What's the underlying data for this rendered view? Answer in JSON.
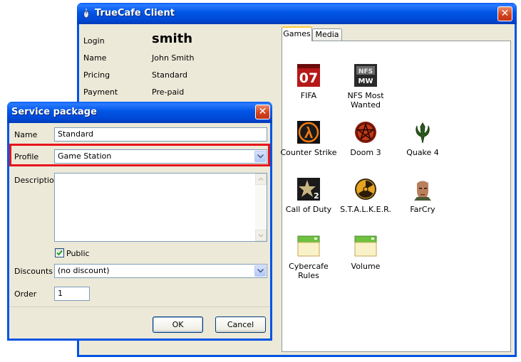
{
  "main_window": {
    "title": "TrueCafe Client",
    "info": [
      {
        "label": "Login",
        "value": "smith"
      },
      {
        "label": "Name",
        "value": "John Smith"
      },
      {
        "label": "Pricing",
        "value": "Standard"
      },
      {
        "label": "Payment",
        "value": "Pre-paid"
      }
    ],
    "tabs": [
      {
        "label": "Games",
        "selected": true
      },
      {
        "label": "Media",
        "selected": false
      }
    ],
    "games": [
      {
        "label": "FIFA",
        "icon": "fifa-icon"
      },
      {
        "label": "NFS Most Wanted",
        "icon": "nfs-icon"
      },
      {
        "label": "Counter Strike",
        "icon": "half-life-lambda-icon"
      },
      {
        "label": "Doom 3",
        "icon": "pentagram-icon"
      },
      {
        "label": "Quake 4",
        "icon": "quake-logo-icon"
      },
      {
        "label": "Call of Duty",
        "icon": "star-2-icon"
      },
      {
        "label": "S.T.A.L.K.E.R.",
        "icon": "radiation-icon"
      },
      {
        "label": "FarCry",
        "icon": "face-icon"
      },
      {
        "label": "Cybercafe Rules",
        "icon": "folder-icon"
      },
      {
        "label": "Volume",
        "icon": "folder-icon"
      }
    ]
  },
  "dialog": {
    "title": "Service package",
    "name_label": "Name",
    "name_value": "Standard",
    "profile_label": "Profile",
    "profile_value": "Game Station",
    "description_label": "Description",
    "description_value": "",
    "public_label": "Public",
    "public_checked": true,
    "discounts_label": "Discounts",
    "discounts_value": "(no discount)",
    "order_label": "Order",
    "order_value": "1",
    "ok_label": "OK",
    "cancel_label": "Cancel"
  },
  "colors": {
    "titlebar": "#0054e3",
    "highlight": "#e8131c",
    "window_bg": "#ece9d8"
  }
}
